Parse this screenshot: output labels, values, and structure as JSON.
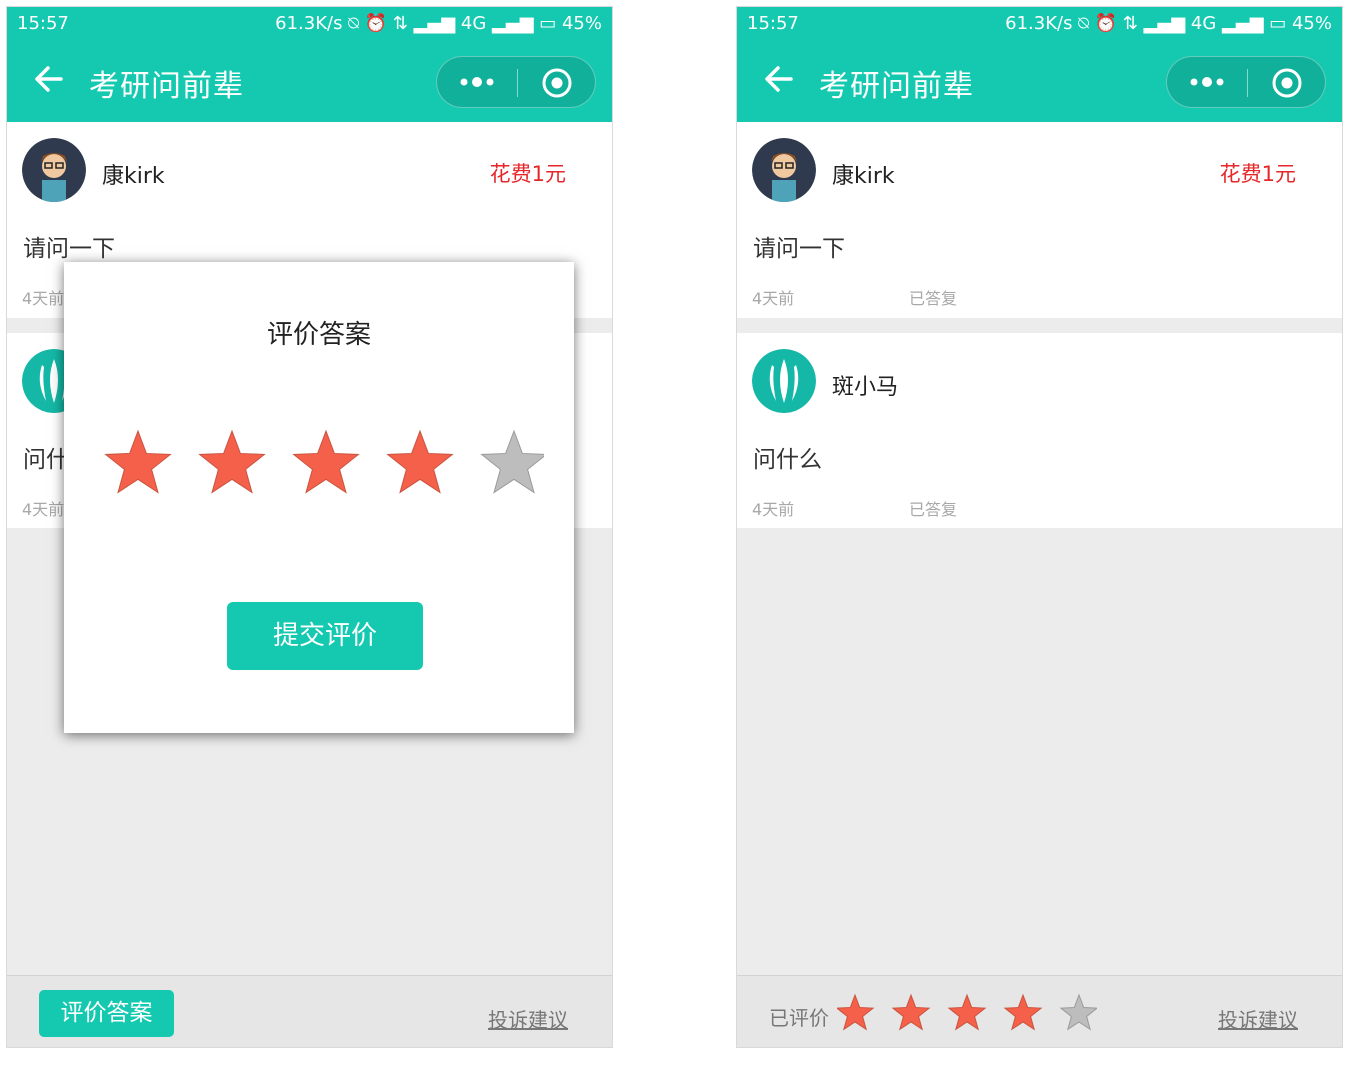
{
  "status_bar": {
    "time": "15:57",
    "info": "61.3K/s ⍉ ⏰ ⇅ ▂▄▆ 4G ▂▄▆ ▭ 45%"
  },
  "nav": {
    "title": "考研问前辈"
  },
  "questions": [
    {
      "user": "康kirk",
      "cost": "花费1元",
      "text": "请问一下",
      "time": "4天前",
      "status": "已答复"
    },
    {
      "user": "斑小马",
      "text": "问什么",
      "time": "4天前",
      "status": "已答复"
    }
  ],
  "modal": {
    "title": "评价答案",
    "rating": 4,
    "max_rating": 5,
    "submit_label": "提交评价"
  },
  "footer_left": {
    "rate_button": "评价答案",
    "complain": "投诉建议"
  },
  "footer_right": {
    "rated_label": "已评价",
    "rating": 4,
    "max_rating": 5,
    "complain": "投诉建议"
  },
  "colors": {
    "accent": "#14c9b0",
    "star_on": "#f4604a",
    "star_off": "#bdbdbd",
    "cost": "#e5262a"
  }
}
